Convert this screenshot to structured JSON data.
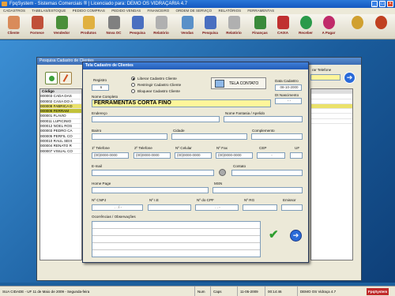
{
  "window": {
    "title": "FpqSystem - Sistemas Comerciais ® | Licenciado para: DEMO OS VIDRAÇARIA 4.7"
  },
  "menu": [
    "CADASTROS",
    "TABELAS/ESTOQUE",
    "PEDIDO COMPRAS",
    "PEDIDO VENDAS",
    "FINANCEIRO",
    "ORDEM DE SERVIÇO",
    "RELATÓRIOS",
    "FERRAMENTAS"
  ],
  "toolbar": [
    {
      "label": "Cliente",
      "icon": "client-icon",
      "color": "#d98b5a"
    },
    {
      "label": "Fornece",
      "icon": "supplier-icon",
      "color": "#c0503a"
    },
    {
      "label": "Vendedor",
      "icon": "seller-icon",
      "color": "#4a8f3a"
    },
    {
      "label": "Produtos",
      "icon": "products-icon",
      "color": "#e0b040"
    },
    {
      "label": "Nova OC",
      "icon": "new-order-icon",
      "color": "#808080"
    },
    {
      "label": "Pesquisa",
      "icon": "search-icon",
      "color": "#4a6fc0"
    },
    {
      "label": "Relatório",
      "icon": "report-icon",
      "color": "#b0b0b0"
    },
    {
      "label": "Vendas",
      "icon": "sales-icon",
      "color": "#5a90c8"
    },
    {
      "label": "Pesquisa",
      "icon": "search-icon",
      "color": "#4a6fc0"
    },
    {
      "label": "Relatório",
      "icon": "report-icon",
      "color": "#b0b0b0"
    },
    {
      "label": "Finanças",
      "icon": "finance-icon",
      "color": "#3a8a3a"
    },
    {
      "label": "CAIXA",
      "icon": "cashier-icon",
      "color": "#c03030"
    },
    {
      "label": "Receber",
      "icon": "receive-icon",
      "color": "#2a9a4a"
    },
    {
      "label": "A Pagar",
      "icon": "pay-icon",
      "color": "#c02a6a"
    },
    {
      "label": "",
      "icon": "settings-icon",
      "color": "#d0a030"
    },
    {
      "label": "",
      "icon": "power-icon",
      "color": "#c04020"
    }
  ],
  "bg_window": {
    "title": "Pesquisa Cadastro de Clientes",
    "col_code": "Código",
    "right_label": "rar Telefone",
    "rows": [
      {
        "code": "000003",
        "name": "CADA DAS"
      },
      {
        "code": "000002",
        "name": "CASA DO A"
      },
      {
        "code": "000008",
        "name": "FABRICA D"
      },
      {
        "code": "000006",
        "name": "FERRAM"
      },
      {
        "code": "000001",
        "name": "FLAVIO"
      },
      {
        "code": "000011",
        "name": "LUPICINIO"
      },
      {
        "code": "000012",
        "name": "NOEL ROS"
      },
      {
        "code": "000003",
        "name": "PEDRO CA"
      },
      {
        "code": "000005",
        "name": "PERFIL CO"
      },
      {
        "code": "000010",
        "name": "RAUL SEIX"
      },
      {
        "code": "000004",
        "name": "RENATO R"
      },
      {
        "code": "000007",
        "name": "VISUAL CO"
      }
    ]
  },
  "dialog": {
    "title": "Tela Cadastro de Clientes",
    "registro_label": "Registro",
    "registro_value": "6",
    "radios": [
      {
        "label": "Liberar Cadastro Cliente",
        "checked": true
      },
      {
        "label": "Restringir Cadastro Cliente",
        "checked": false
      },
      {
        "label": "Bloquear Cadastro Cliente",
        "checked": false
      }
    ],
    "tela_contato": "TELA CONTATO",
    "data_cadastro_label": "Data Cadastro",
    "data_cadastro_value": "08-10-2000",
    "dt_nasc_label": "Dt Nascimento",
    "dt_nasc_value": "- -",
    "nome_label": "Nome Completo",
    "nome_value": "FERRAMENTAS CORTA FINO",
    "endereco_label": "Endereço",
    "fantasia_label": "Nome Fantasia / Apelido",
    "bairro_label": "Bairro",
    "cidade_label": "Cidade",
    "complemento_label": "Complemento",
    "tel1_label": "1º Telefone",
    "tel1_value": "(00)0000-0000",
    "tel2_label": "2º Telefone",
    "tel2_value": "(00)0000-0000",
    "celular_label": "Nº Celular",
    "celular_value": "(00)0000-0000",
    "fax_label": "Nº Fax",
    "fax_value": "(00)0000-0000",
    "cep_label": "CEP",
    "cep_value": "-",
    "uf_label": "UF",
    "email_label": "E-mail",
    "contato_label": "Contato",
    "homepage_label": "Home Page",
    "msn_label": "MSN",
    "cnpj_label": "Nº CNPJ",
    "cnpj_value": ". . / -",
    "ie_label": "Nº I.E",
    "cpf_label": "Nº do CPF",
    "cpf_value": ". . -",
    "rg_label": "Nº RG",
    "emissor_label": "Emissor",
    "obs_label": "Ocorrências / Observações"
  },
  "status": {
    "city": "SUA CIDADE - UF 11 de Maio de 2009 - Segunda-feira",
    "num": "Num",
    "caps": "Caps",
    "date": "11-05-2009",
    "time": "00:14:46",
    "version": "DEMO OS Vidraça 4.7",
    "brand": "FpqSystem"
  }
}
